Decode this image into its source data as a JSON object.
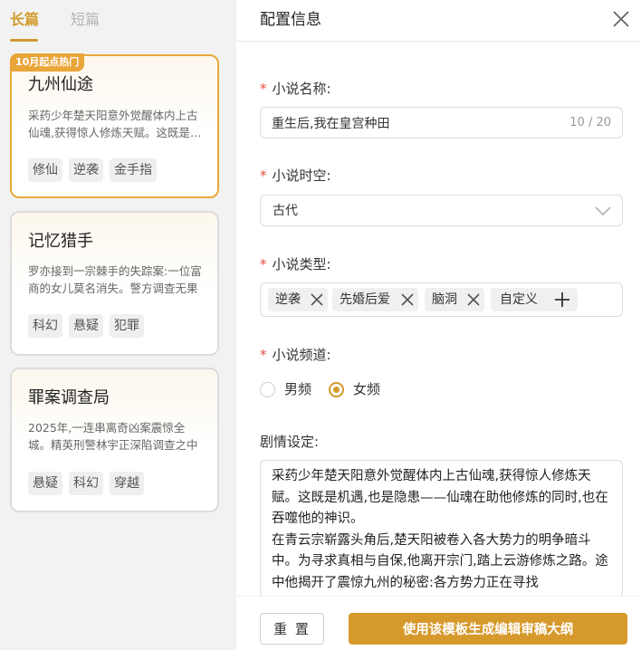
{
  "tabs": [
    {
      "label": "长篇",
      "active": true
    },
    {
      "label": "短篇",
      "active": false
    }
  ],
  "cards": [
    {
      "badge": "10月起点热门",
      "title": "九州仙途",
      "desc": "采药少年楚天阳意外觉醒体内上古仙魂,获得惊人修炼天赋。这既是机遇,也是隐患",
      "tags": [
        "修仙",
        "逆袭",
        "金手指"
      ],
      "selected": true
    },
    {
      "title": "记忆猎手",
      "desc": "罗亦接到一宗棘手的失踪案:一位富商的女儿莫名消失。警方调查无果",
      "tags": [
        "科幻",
        "悬疑",
        "犯罪"
      ],
      "selected": false
    },
    {
      "title": "罪案调查局",
      "desc": "2025年,一连串离奇凶案震惊全城。精英刑警林宇正深陷调查之中",
      "tags": [
        "悬疑",
        "科幻",
        "穿越"
      ],
      "selected": false
    }
  ],
  "panel": {
    "title": "配置信息",
    "required_mark": "*",
    "name_label": "小说名称:",
    "name_value": "重生后,我在皇宫种田",
    "name_counter": "10 / 20",
    "era_label": "小说时空:",
    "era_value": "古代",
    "type_label": "小说类型:",
    "type_chips": [
      "逆袭",
      "先婚后爱",
      "脑洞"
    ],
    "custom_label": "自定义",
    "channel_label": "小说频道:",
    "channels": [
      {
        "label": "男频",
        "checked": false
      },
      {
        "label": "女频",
        "checked": true
      }
    ],
    "plot_label": "剧情设定:",
    "plot_text": "采药少年楚天阳意外觉醒体内上古仙魂,获得惊人修炼天赋。这既是机遇,也是隐患——仙魂在助他修炼的同时,也在吞噬他的神识。\n在青云宗崭露头角后,楚天阳被卷入各大势力的明争暗斗中。为寻求真相与自保,他离开宗门,踏上云游修炼之路。途中他揭开了震惊九州的秘密:各方势力正在寻找",
    "reset_label": "重 置",
    "generate_label": "使用该模板生成编辑审稿大纲"
  },
  "colors": {
    "accent": "#d29a2b",
    "badge": "#eaa539",
    "required": "#e64c3c"
  }
}
